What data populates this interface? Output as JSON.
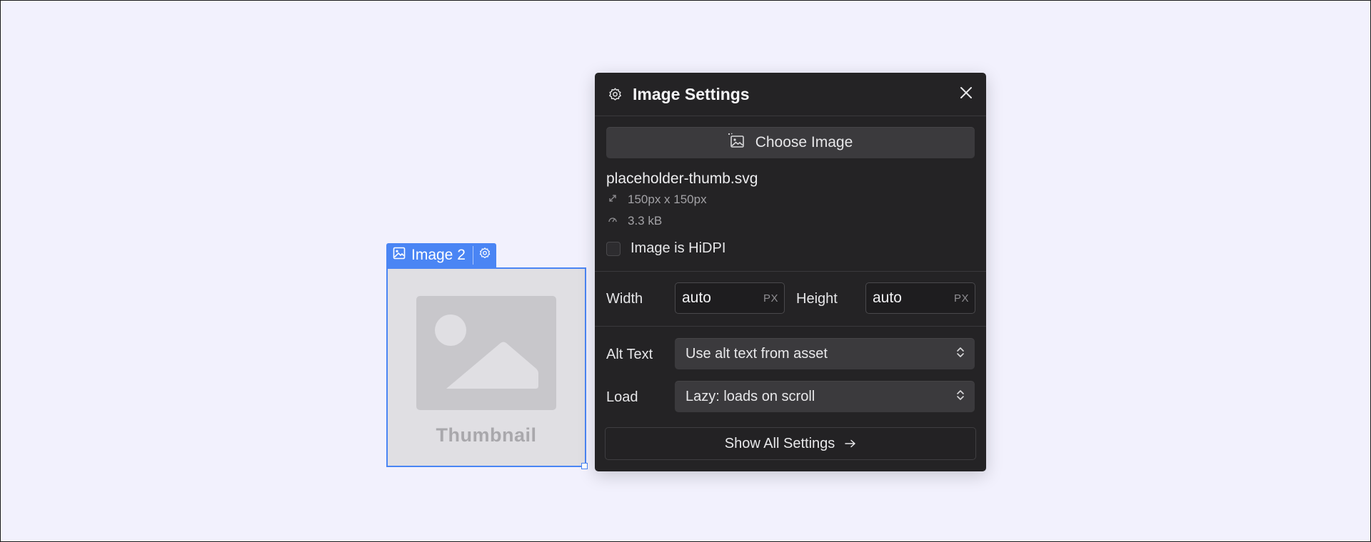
{
  "colors": {
    "canvas_bg": "#f2f1fd",
    "selection_blue": "#4a85f4",
    "panel_bg": "#242325",
    "placeholder_bg": "#e0dfe3",
    "placeholder_art": "#c8c7cb"
  },
  "canvas_element": {
    "tag_label": "Image 2",
    "tag_icon": "image-icon",
    "settings_icon": "gear-icon",
    "placeholder_caption": "Thumbnail"
  },
  "panel": {
    "title": "Image Settings",
    "title_icon": "gear-icon",
    "close_icon": "close-icon",
    "choose_image_label": "Choose Image",
    "file": {
      "name": "placeholder-thumb.svg",
      "dimensions": "150px x 150px",
      "size": "3.3 kB"
    },
    "hidpi_label": "Image is HiDPI",
    "hidpi_checked": false,
    "width": {
      "label": "Width",
      "value": "auto",
      "unit": "PX"
    },
    "height": {
      "label": "Height",
      "value": "auto",
      "unit": "PX"
    },
    "alt_text": {
      "label": "Alt Text",
      "value": "Use alt text from asset"
    },
    "load": {
      "label": "Load",
      "value": "Lazy: loads on scroll"
    },
    "show_all_label": "Show All Settings"
  }
}
